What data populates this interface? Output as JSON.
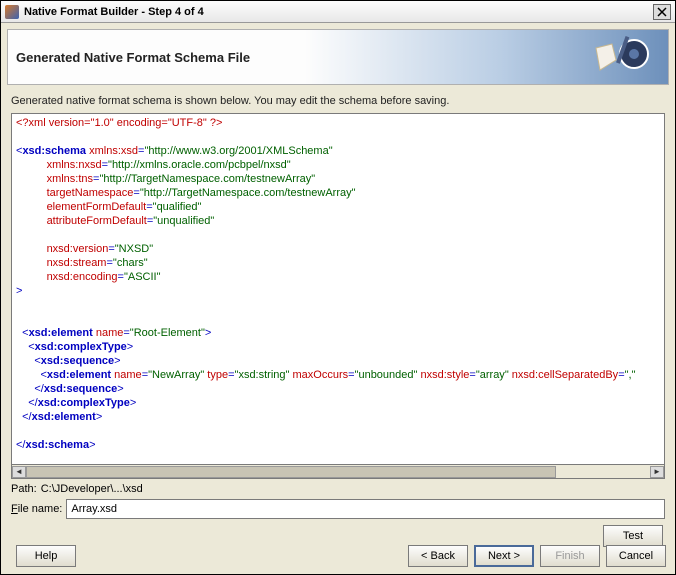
{
  "window": {
    "title": "Native Format Builder - Step 4 of 4"
  },
  "banner": {
    "heading": "Generated Native Format Schema File"
  },
  "instruction": "Generated native format schema is shown below. You may edit the schema before saving.",
  "xml": {
    "pi": "<?xml version=\"1.0\" encoding=\"UTF-8\" ?>",
    "schema_open": "xsd:schema",
    "xmlns_xsd_attr": "xmlns:xsd",
    "xmlns_xsd_val": "http://www.w3.org/2001/XMLSchema",
    "xmlns_nxsd_attr": "xmlns:nxsd",
    "xmlns_nxsd_val": "http://xmlns.oracle.com/pcbpel/nxsd",
    "xmlns_tns_attr": "xmlns:tns",
    "xmlns_tns_val": "http://TargetNamespace.com/testnewArray",
    "tn_attr": "targetNamespace",
    "tn_val": "http://TargetNamespace.com/testnewArray",
    "efd_attr": "elementFormDefault",
    "efd_val": "qualified",
    "afd_attr": "attributeFormDefault",
    "afd_val": "unqualified",
    "nver_attr": "nxsd:version",
    "nver_val": "NXSD",
    "nstream_attr": "nxsd:stream",
    "nstream_val": "chars",
    "nenc_attr": "nxsd:encoding",
    "nenc_val": "ASCII",
    "el_tag": "xsd:element",
    "el_name_attr": "name",
    "el_name_val": "Root-Element",
    "ct_tag": "xsd:complexType",
    "seq_tag": "xsd:sequence",
    "inner_name_val": "NewArray",
    "type_attr": "type",
    "type_val": "xsd:string",
    "max_attr": "maxOccurs",
    "max_val": "unbounded",
    "style_attr": "nxsd:style",
    "style_val": "array",
    "cellsep_attr": "nxsd:cellSeparatedBy",
    "cellsep_val": ",",
    "schema_close": "xsd:schema"
  },
  "path": {
    "label": "Path:",
    "value": "C:\\JDeveloper\\...\\xsd"
  },
  "filename": {
    "label_pre": "F",
    "label_post": "ile name:",
    "value": "Array.xsd"
  },
  "buttons": {
    "test": "Test",
    "help": "Help",
    "back": "< Back",
    "next": "Next >",
    "finish": "Finish",
    "cancel": "Cancel"
  }
}
